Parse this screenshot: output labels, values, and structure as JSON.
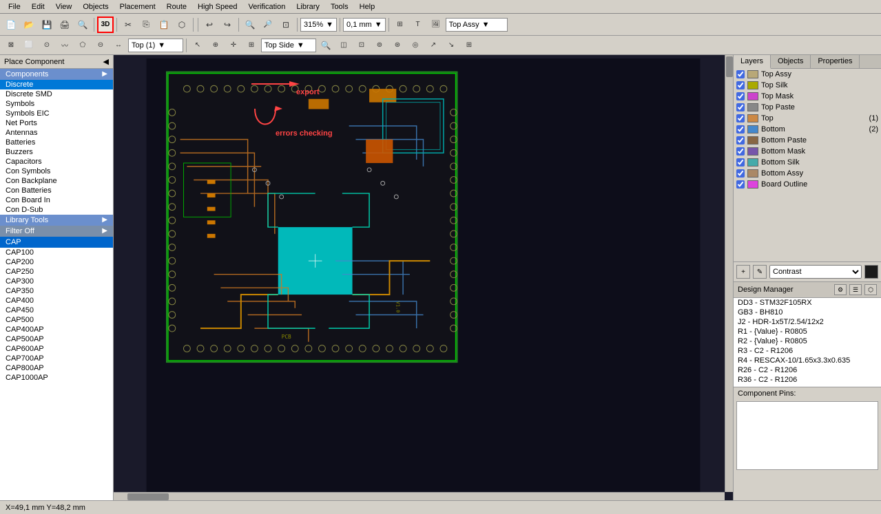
{
  "menubar": {
    "items": [
      "File",
      "Edit",
      "View",
      "Objects",
      "Placement",
      "Route",
      "High Speed",
      "Verification",
      "Library",
      "Tools",
      "Help"
    ]
  },
  "toolbar1": {
    "buttons": [
      "new",
      "open",
      "save",
      "print",
      "print-preview",
      "sep",
      "3d-view",
      "sep",
      "cut",
      "copy",
      "paste",
      "sep",
      "export",
      "sep",
      "undo",
      "redo",
      "sep",
      "zoom-in",
      "zoom-out",
      "zoom-fit",
      "sep",
      "zoom-display"
    ],
    "zoom_value": "315%",
    "unit_value": "0,1 mm",
    "view_value": "Top Assy"
  },
  "toolbar2": {
    "layer_value": "Top (1)",
    "side_value": "Top Side",
    "buttons_right": [
      "search",
      "drc",
      "other"
    ]
  },
  "left_panel": {
    "place_component_label": "Place Component",
    "components_section": "Components",
    "component_categories": [
      "Discrete",
      "Discrete SMD",
      "Symbols",
      "Symbols EIC",
      "Net Ports",
      "Antennas",
      "Batteries",
      "Buzzers",
      "Capacitors",
      "Con Symbols",
      "Con Backplane",
      "Con Batteries",
      "Con Board In",
      "Con D-Sub"
    ],
    "selected_category": "Discrete",
    "library_tools_section": "Library Tools",
    "filter_section": "Filter Off",
    "cap_section": "CAP",
    "cap_items": [
      "CAP100",
      "CAP200",
      "CAP250",
      "CAP300",
      "CAP350",
      "CAP400",
      "CAP450",
      "CAP500",
      "CAP400AP",
      "CAP500AP",
      "CAP600AP",
      "CAP700AP",
      "CAP800AP",
      "CAP1000AP"
    ],
    "selected_cap": "CAP"
  },
  "canvas": {
    "annotation_export": "export",
    "annotation_errors": "errors checking",
    "coords": "X=49,1 mm    Y=48,2 mm"
  },
  "right_panel": {
    "tabs": [
      "Layers",
      "Objects",
      "Properties"
    ],
    "active_tab": "Layers",
    "layers": [
      {
        "name": "Top Assy",
        "color": "#b8a878",
        "visible": true,
        "count": null
      },
      {
        "name": "Top Silk",
        "color": "#ffff00",
        "visible": true,
        "count": null
      },
      {
        "name": "Top Mask",
        "color": "#cc44cc",
        "visible": true,
        "count": null
      },
      {
        "name": "Top Paste",
        "color": "#888888",
        "visible": true,
        "count": null
      },
      {
        "name": "Top",
        "color": "#cc8844",
        "visible": true,
        "count": "(1)"
      },
      {
        "name": "Bottom",
        "color": "#4488cc",
        "visible": true,
        "count": "(2)"
      },
      {
        "name": "Bottom Paste",
        "color": "#886644",
        "visible": true,
        "count": null
      },
      {
        "name": "Bottom Mask",
        "color": "#7755aa",
        "visible": true,
        "count": null
      },
      {
        "name": "Bottom Silk",
        "color": "#44aaaa",
        "visible": true,
        "count": null
      },
      {
        "name": "Bottom Assy",
        "color": "#aa8866",
        "visible": true,
        "count": null
      },
      {
        "name": "Board Outline",
        "color": "#dd44dd",
        "visible": true,
        "count": null
      }
    ],
    "contrast_label": "Contrast",
    "design_manager_label": "Design Manager",
    "design_items": [
      "DD3 - STM32F105RX",
      "GB3 - BH810",
      "J2 - HDR-1x5T/2.54/12x2",
      "R1 - {Value} - R0805",
      "R2 - {Value} - R0805",
      "R3 - C2 - R1206",
      "R4 - RESCAX-10/1.65x3.3x0.635",
      "R26 - C2 - R1206",
      "R36 - C2 - R1206"
    ],
    "component_pins_label": "Component Pins:"
  },
  "statusbar": {
    "coords": "X=49,1 mm    Y=48,2 mm"
  }
}
